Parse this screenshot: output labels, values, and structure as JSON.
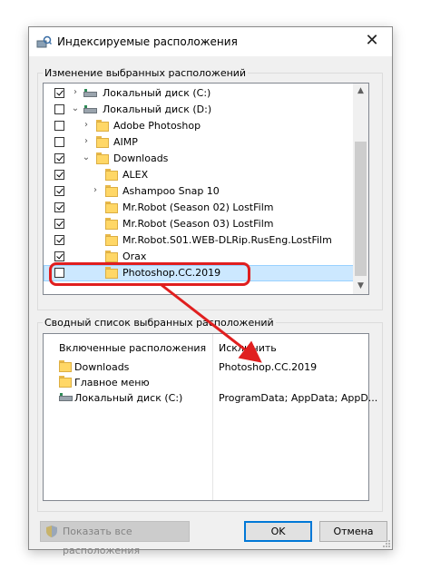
{
  "dialog": {
    "title": "Индексируемые расположения",
    "close_glyph": "✕"
  },
  "group_change": {
    "legend": "Изменение выбранных расположений"
  },
  "tree": {
    "items": [
      {
        "label": "Локальный диск (C:)",
        "checked": true,
        "icon": "drive-icon",
        "expander": "›"
      },
      {
        "label": "Локальный диск (D:)",
        "checked": false,
        "icon": "drive-icon",
        "expander": "⌄"
      },
      {
        "label": "Adobe Photoshop",
        "checked": false,
        "icon": "folder-icon",
        "expander": "›"
      },
      {
        "label": "AIMP",
        "checked": false,
        "icon": "folder-icon",
        "expander": "›"
      },
      {
        "label": "Downloads",
        "checked": true,
        "icon": "folder-icon",
        "expander": "⌄"
      },
      {
        "label": "ALEX",
        "checked": true,
        "icon": "folder-icon",
        "expander": ""
      },
      {
        "label": "Ashampoo Snap 10",
        "checked": true,
        "icon": "folder-icon",
        "expander": "›"
      },
      {
        "label": "Mr.Robot (Season 02) LostFilm",
        "checked": true,
        "icon": "folder-icon",
        "expander": ""
      },
      {
        "label": "Mr.Robot (Season 03) LostFilm",
        "checked": true,
        "icon": "folder-icon",
        "expander": ""
      },
      {
        "label": "Mr.Robot.S01.WEB-DLRip.RusEng.LostFilm",
        "checked": true,
        "icon": "folder-icon",
        "expander": ""
      },
      {
        "label": "Orax",
        "checked": true,
        "icon": "folder-icon",
        "expander": ""
      },
      {
        "label": "Photoshop.CC.2019",
        "checked": false,
        "icon": "folder-icon",
        "expander": "",
        "selected": true
      }
    ],
    "scroll_up": "▲",
    "scroll_down": "▼"
  },
  "group_summary": {
    "legend": "Сводный список выбранных расположений",
    "included_header": "Включенные расположения",
    "excluded_header": "Исключить",
    "included": [
      {
        "label": "Downloads",
        "icon": "folder-icon"
      },
      {
        "label": "Главное меню",
        "icon": "folder-icon"
      },
      {
        "label": "Локальный диск (C:)",
        "icon": "drive-icon"
      }
    ],
    "excluded": [
      "Photoshop.CC.2019",
      "",
      "ProgramData; AppData; AppD..."
    ]
  },
  "buttons": {
    "show_all": "Показать все расположения",
    "ok": "OK",
    "cancel": "Отмена"
  },
  "colors": {
    "annotation": "#e01f1f",
    "selection": "#cce8ff",
    "ok_border": "#0078d7"
  }
}
